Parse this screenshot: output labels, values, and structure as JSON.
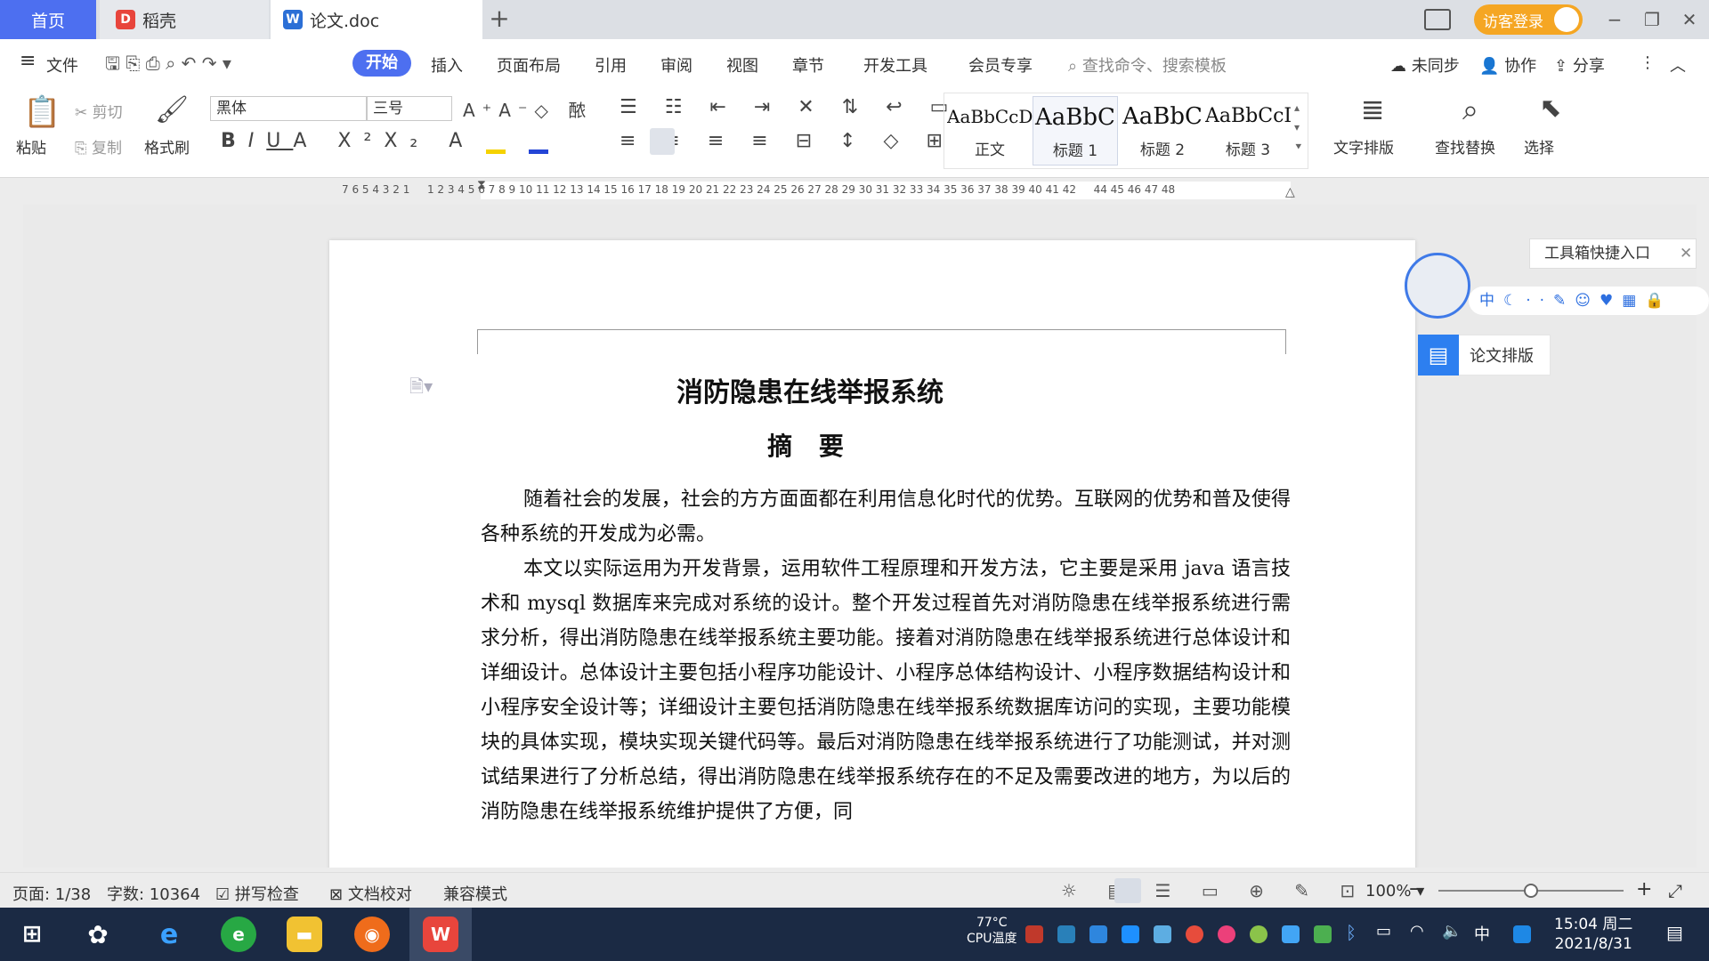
{
  "tabs": {
    "home": "首页",
    "daoke": "稻壳",
    "doc": "论文.doc",
    "new_tab": "+"
  },
  "titlebar": {
    "guest_login": "访客登录",
    "minimize": "−",
    "restore": "❐",
    "close": "✕"
  },
  "menu": {
    "file": "文件",
    "items": [
      "开始",
      "插入",
      "页面布局",
      "引用",
      "审阅",
      "视图",
      "章节",
      "开发工具",
      "会员专享"
    ],
    "search_placeholder": "查找命令、搜索模板",
    "unsynced": "未同步",
    "collab": "协作",
    "share": "分享"
  },
  "ribbon": {
    "paste": "粘贴",
    "cut": "剪切",
    "copy": "复制",
    "format_painter": "格式刷",
    "font_name": "黑体",
    "font_size": "三号",
    "styles": [
      {
        "sample": "AaBbCcDd",
        "name": "正文"
      },
      {
        "sample": "AaBbC",
        "name": "标题 1"
      },
      {
        "sample": "AaBbC",
        "name": "标题 2"
      },
      {
        "sample": "AaBbCcI",
        "name": "标题 3"
      }
    ],
    "text_layout": "文字排版",
    "find_replace": "查找替换",
    "select": "选择"
  },
  "ruler": {
    "numbers": "7 6 5 4 3 2 1 　 1 2 3 4 5 6 7 8 9 10 11 12 13 14 15 16 17 18 19 20 21 22 23 24 25 26 27 28 29 30 31 32 33 34 35 36 37 38 39 40 41 42 　 44 45 46 47 48"
  },
  "document": {
    "title": "消防隐患在线举报系统",
    "abstract_heading": "摘 要",
    "para1": "随着社会的发展，社会的方方面面都在利用信息化时代的优势。互联网的优势和普及使得各种系统的开发成为必需。",
    "para2": "本文以实际运用为开发背景，运用软件工程原理和开发方法，它主要是采用 java 语言技术和 mysql 数据库来完成对系统的设计。整个开发过程首先对消防隐患在线举报系统进行需求分析，得出消防隐患在线举报系统主要功能。接着对消防隐患在线举报系统进行总体设计和详细设计。总体设计主要包括小程序功能设计、小程序总体结构设计、小程序数据结构设计和小程序安全设计等；详细设计主要包括消防隐患在线举报系统数据库访问的实现，主要功能模块的具体实现，模块实现关键代码等。最后对消防隐患在线举报系统进行了功能测试，并对测试结果进行了分析总结，得出消防隐患在线举报系统存在的不足及需要改进的地方，为以后的消防隐患在线举报系统维护提供了方便，同"
  },
  "toolbox": {
    "entry": "工具箱快捷入口",
    "paper_layout": "论文排版",
    "zh": "中"
  },
  "status": {
    "page": "页面: 1/38",
    "words": "字数: 10364",
    "spell_check": "拼写检查",
    "proofread": "文档校对",
    "compat_mode": "兼容模式",
    "zoom": "100%",
    "zoom_level": 0.5
  },
  "taskbar": {
    "cpu_temp": "77°C",
    "cpu_label": "CPU温度",
    "ime": "中",
    "time": "15:04 周二",
    "date": "2021/8/31"
  },
  "colors": {
    "accent": "#4d6ff0",
    "guest": "#f5a623",
    "taskbar": "#1b2a44"
  }
}
